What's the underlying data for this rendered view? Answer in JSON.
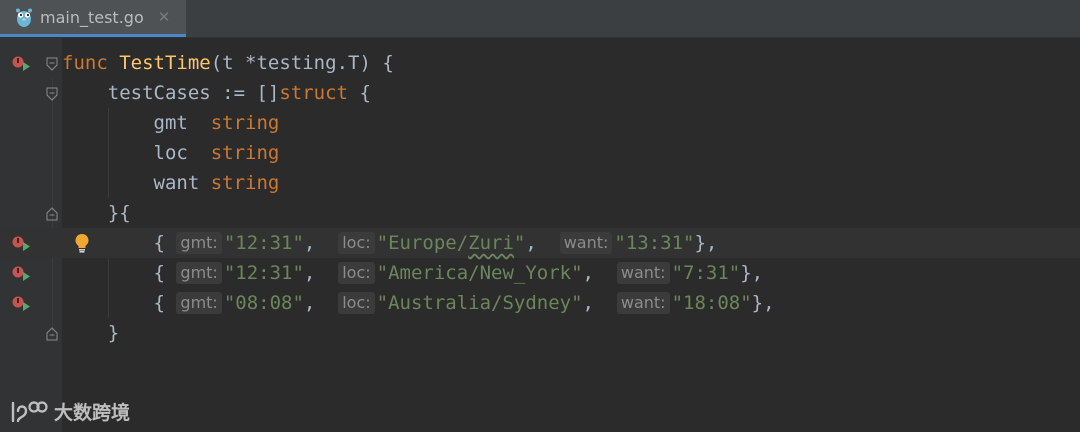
{
  "tab": {
    "filename": "main_test.go",
    "close": "✕",
    "icon": "go-gopher-icon"
  },
  "code": {
    "line1": {
      "kw": "func",
      "name": "TestTime",
      "params_open": "(t *testing.",
      "type": "T",
      "params_close": ") {"
    },
    "line2": {
      "ident": "testCases := []",
      "kw": "struct",
      "brace": " {"
    },
    "fields": [
      {
        "name": "gmt ",
        "type": "string"
      },
      {
        "name": "loc ",
        "type": "string"
      },
      {
        "name": "want",
        "type": "string"
      }
    ],
    "line6": "}{",
    "cases": [
      {
        "gmt": "\"12:31\"",
        "loc_prefix": "\"Europe/",
        "loc_wavy": "Zuri",
        "loc_suffix": "\"",
        "want": "\"13:31\"",
        "tail": "},"
      },
      {
        "gmt": "\"12:31\"",
        "loc_prefix": "\"America/New_York\"",
        "loc_wavy": "",
        "loc_suffix": "",
        "want": "\"7:31\"",
        "tail": "},"
      },
      {
        "gmt": "\"08:08\"",
        "loc_prefix": "\"Australia/Sydney\"",
        "loc_wavy": "",
        "loc_suffix": "",
        "want": "\"18:08\"",
        "tail": "},"
      }
    ],
    "hints": {
      "gmt": "gmt:",
      "loc": "loc:",
      "want": "want:"
    },
    "open_brace": "{ ",
    "close": "}"
  },
  "watermark": {
    "text": "大数跨境",
    "icon": "logo-icon"
  },
  "colors": {
    "background": "#2b2b2b",
    "keyword": "#cc7832",
    "function": "#ffc66d",
    "string": "#6a8759",
    "hint_bg": "#3b3b3b",
    "run_icon": "#c75450",
    "run_arrow": "#59a869"
  }
}
